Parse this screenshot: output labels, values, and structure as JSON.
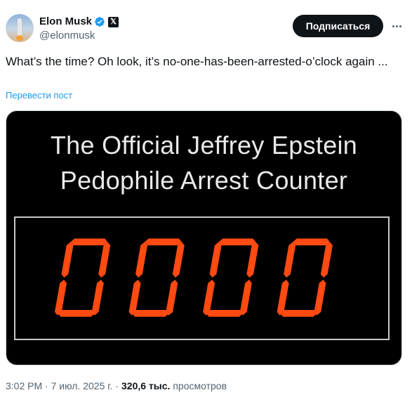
{
  "author": {
    "name": "Elon Musk",
    "handle": "@elonmusk",
    "verified_icon": "verified-badge-icon",
    "affiliate_icon": "x-logo-icon",
    "affiliate_glyph": "𝕏"
  },
  "actions": {
    "follow_label": "Подписаться",
    "more_icon": "more-options-icon"
  },
  "tweet": {
    "text": "What’s the time? Oh look, it’s no-one-has-been-arrested-o’clock again ...",
    "translate_label": "Перевести пост"
  },
  "media": {
    "title_line1": "The Official Jeffrey Epstein",
    "title_line2": "Pedophile Arrest Counter",
    "counter_value": "0000"
  },
  "meta": {
    "time": "3:02 PM",
    "sep1": " · ",
    "date": "7 июл. 2025 г.",
    "sep2": " · ",
    "views_count": "320,6 тыс.",
    "views_label": " просмотров"
  },
  "colors": {
    "link": "#1d9bf0",
    "verified": "#1d9bf0",
    "segment": "#ff4a12",
    "text_primary": "#0f1419",
    "text_secondary": "#536471"
  }
}
